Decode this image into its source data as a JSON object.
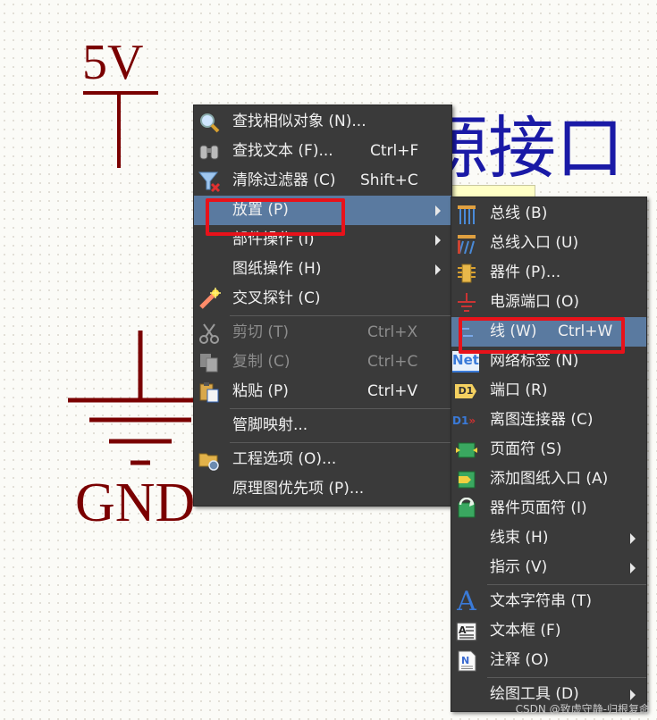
{
  "schematic": {
    "power_label": "5V",
    "ground_label": "GND",
    "title_text": "源接口"
  },
  "context_menu": {
    "items": [
      {
        "label": "查找相似对象 (N)...",
        "shortcut": "",
        "icon": "search-similar-icon"
      },
      {
        "label": "查找文本 (F)...",
        "shortcut": "Ctrl+F",
        "icon": "binoculars-icon"
      },
      {
        "label": "清除过滤器 (C)",
        "shortcut": "Shift+C",
        "icon": "clear-filter-icon"
      },
      {
        "label": "放置 (P)",
        "shortcut": "",
        "submenu": true
      },
      {
        "label": "部件操作 (I)",
        "shortcut": "",
        "submenu": true
      },
      {
        "label": "图纸操作 (H)",
        "shortcut": "",
        "submenu": true
      },
      {
        "label": "交叉探针 (C)",
        "shortcut": "",
        "icon": "cross-probe-icon"
      },
      {
        "label": "剪切 (T)",
        "shortcut": "Ctrl+X",
        "icon": "scissors-icon",
        "disabled": true
      },
      {
        "label": "复制 (C)",
        "shortcut": "Ctrl+C",
        "icon": "copy-icon",
        "disabled": true
      },
      {
        "label": "粘贴 (P)",
        "shortcut": "Ctrl+V",
        "icon": "paste-icon"
      },
      {
        "label": "管脚映射...",
        "shortcut": ""
      },
      {
        "label": "工程选项 (O)...",
        "shortcut": "",
        "icon": "project-options-icon"
      },
      {
        "label": "原理图优先项 (P)...",
        "shortcut": ""
      }
    ]
  },
  "place_submenu": {
    "items": [
      {
        "label": "总线 (B)",
        "icon": "bus-icon"
      },
      {
        "label": "总线入口 (U)",
        "icon": "bus-entry-icon"
      },
      {
        "label": "器件 (P)...",
        "icon": "component-icon"
      },
      {
        "label": "电源端口 (O)",
        "icon": "power-port-icon"
      },
      {
        "label": "线 (W)",
        "shortcut": "Ctrl+W",
        "icon": "wire-icon"
      },
      {
        "label": "网络标签 (N)",
        "icon": "net-label-icon",
        "icon_text": "Net"
      },
      {
        "label": "端口 (R)",
        "icon": "port-icon",
        "icon_text": "D1"
      },
      {
        "label": "离图连接器 (C)",
        "icon": "off-sheet-connector-icon",
        "icon_text": "D1"
      },
      {
        "label": "页面符 (S)",
        "icon": "sheet-symbol-icon"
      },
      {
        "label": "添加图纸入口 (A)",
        "icon": "sheet-entry-icon"
      },
      {
        "label": "器件页面符 (I)",
        "icon": "device-sheet-symbol-icon"
      },
      {
        "label": "线束 (H)",
        "submenu": true
      },
      {
        "label": "指示 (V)",
        "submenu": true
      },
      {
        "label": "文本字符串 (T)",
        "icon": "text-string-icon",
        "icon_text": "A"
      },
      {
        "label": "文本框 (F)",
        "icon": "text-frame-icon"
      },
      {
        "label": "注释 (O)",
        "icon": "note-icon"
      },
      {
        "label": "绘图工具 (D)",
        "submenu": true
      }
    ]
  },
  "watermark": "CSDN @致虚守静-归根复命"
}
